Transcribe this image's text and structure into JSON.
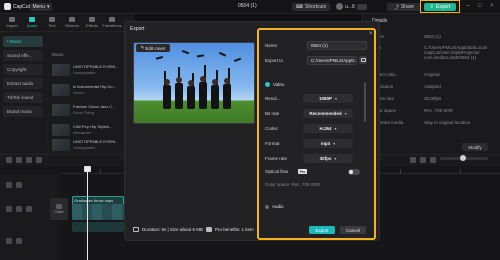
{
  "app": {
    "name": "CapCut",
    "menu_label": "Menu",
    "project_title": "0504 (1)",
    "shortcuts_label": "Shortcuts",
    "user_label": "u...8",
    "share_label": "Share",
    "export_label": "Export"
  },
  "tools": [
    "Import",
    "Audio",
    "Text",
    "Stickers",
    "Effects",
    "Transitions"
  ],
  "sidebar": {
    "items": [
      {
        "label": "• Music"
      },
      {
        "label": "Sound effe..."
      },
      {
        "label": "Copyright"
      },
      {
        "label": "Extract audio"
      },
      {
        "label": "TikTok sound"
      },
      {
        "label": "Brand music"
      }
    ]
  },
  "assets": {
    "header": "Music",
    "items": [
      {
        "title": "UNSTOPPABLE EVENI...",
        "sub": "Unstoppable"
      },
      {
        "title": "ls Instrumental Hip-Ho...",
        "sub": "Xenon"
      },
      {
        "title": "Fashion Clean Jazz C...",
        "sub": "Good Thing"
      },
      {
        "title": "Chill Pop Hip Stylish ...",
        "sub": "Alexander"
      },
      {
        "title": "UNSTOPPABLE EVENI...",
        "sub": "Unstoppable"
      }
    ]
  },
  "details": {
    "title": "Details",
    "rows": [
      {
        "k": "Name",
        "v": "0504 (1)"
      },
      {
        "k": "Path",
        "v": "C:/Users/PMLS/AppData/Local/\nCapCut/User Data/Projects/\ncom.lveditor.draft/0504 (1)"
      },
      {
        "k": "Aspect ratio",
        "v": "Original"
      },
      {
        "k": "Resolution",
        "v": "Adapted"
      },
      {
        "k": "Frame rate",
        "v": "30.00fps"
      },
      {
        "k": "Color space",
        "v": "Rec. 709 SDR"
      },
      {
        "k": "Imported media",
        "v": "Stay in original location"
      }
    ],
    "modify_label": "Modify"
  },
  "timeline": {
    "cover_label": "Cover",
    "clip_label": "Graduates throw caps"
  },
  "dialog": {
    "title": "Export",
    "edit_cover_label": "Edit cover",
    "footer": {
      "duration_text": "Duration: 6s | Size about 5 MB",
      "pro_text": "Pro benefits: 1 item"
    },
    "close_icon": "×",
    "name_label": "Name",
    "name_value": "0504 (1)",
    "export_to_label": "Export to",
    "export_to_value": "C:/Users/PMLS/AppD...",
    "video_section": "Video",
    "resolution_label": "Resol...",
    "resolution_value": "1080P",
    "bitrate_label": "Bit rate",
    "bitrate_value": "Recommended",
    "codec_label": "Codec",
    "codec_value": "H.264",
    "format_label": "Format",
    "format_value": "mp4",
    "framerate_label": "Frame rate",
    "framerate_value": "30fps",
    "optical_flow_label": "Optical flow",
    "pro_badge": "Pro",
    "color_space_text": "Color space: Rec. 709 SDR",
    "audio_section": "Audio",
    "export_button": "Export",
    "cancel_button": "Cancel"
  },
  "colors": {
    "accent": "#1cb8ba",
    "highlight_border": "#f5b320",
    "export_green": "#1fb58f"
  }
}
